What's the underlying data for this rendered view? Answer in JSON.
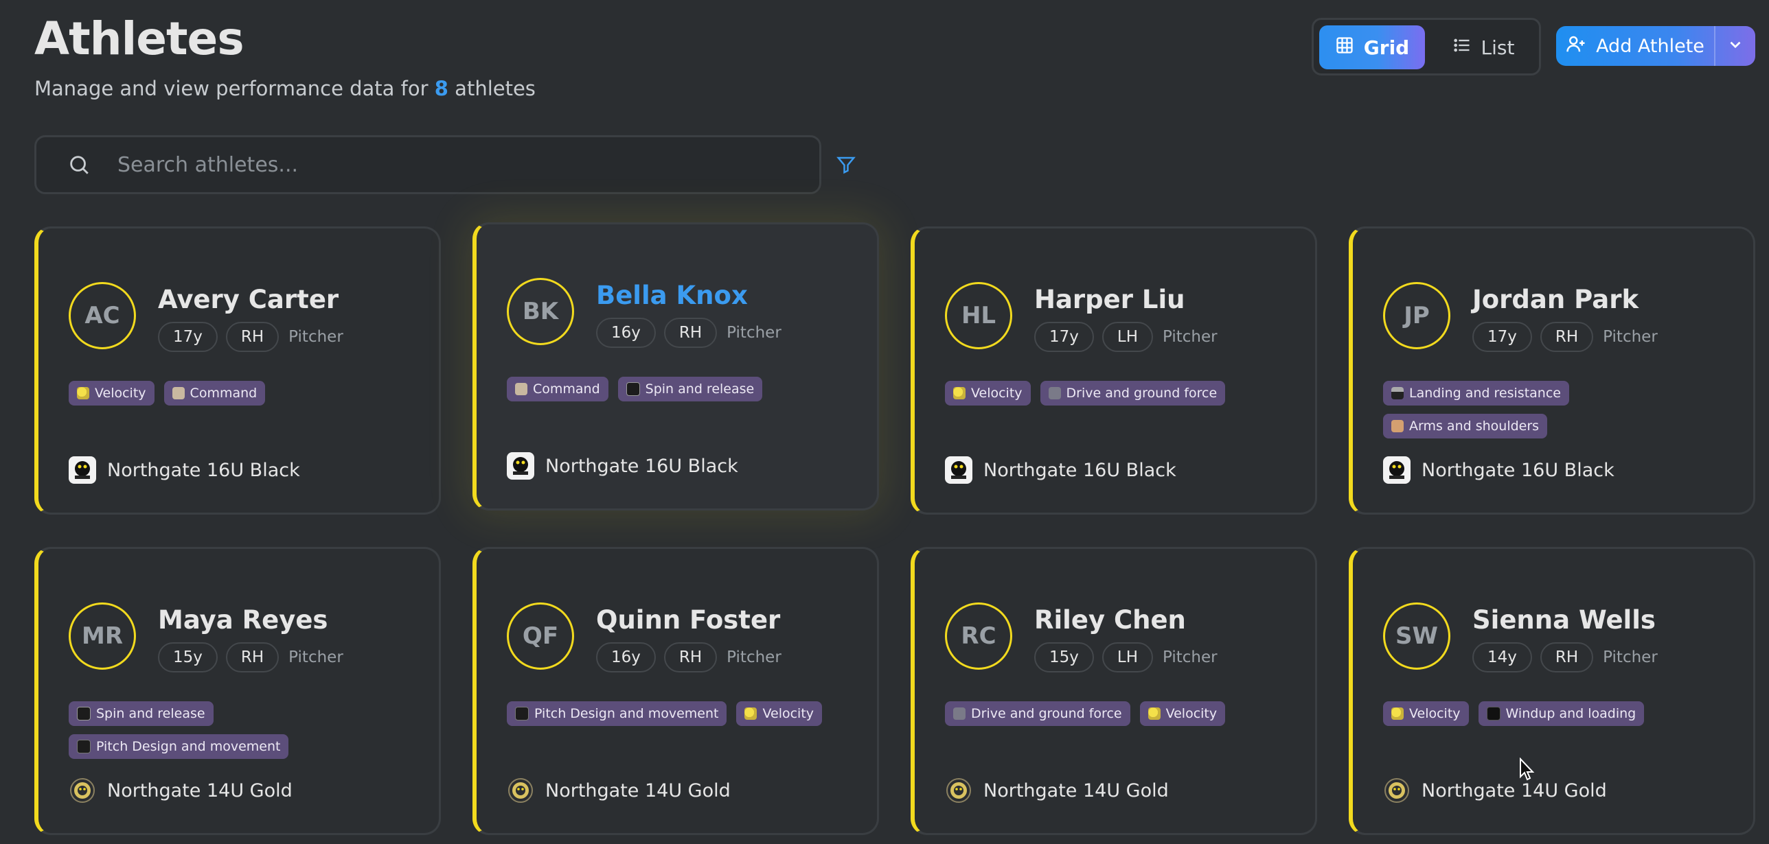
{
  "header": {
    "title": "Athletes",
    "subtitle_prefix": "Manage and view performance data for ",
    "athlete_count": "8",
    "subtitle_suffix": " athletes"
  },
  "view_toggle": {
    "grid_label": "Grid",
    "list_label": "List",
    "selected": "Grid"
  },
  "add_button": {
    "label": "Add Athlete"
  },
  "search": {
    "placeholder": "Search athletes...",
    "value": ""
  },
  "colors": {
    "accent": "#3b9bf0",
    "card_stripe": "#f2da1e",
    "tag_bg": "#5c4e7a",
    "background": "#2b2e31"
  },
  "athletes": [
    {
      "initials": "AC",
      "name": "Avery Carter",
      "age": "17y",
      "hand": "RH",
      "role": "Pitcher",
      "tags": [
        {
          "label": "Velocity",
          "icon": "velocity"
        },
        {
          "label": "Command",
          "icon": "command"
        }
      ],
      "team": "Northgate 16U Black",
      "team_logo": "black"
    },
    {
      "initials": "BK",
      "name": "Bella Knox",
      "age": "16y",
      "hand": "RH",
      "role": "Pitcher",
      "tags": [
        {
          "label": "Command",
          "icon": "command"
        },
        {
          "label": "Spin and release",
          "icon": "spin"
        }
      ],
      "team": "Northgate 16U Black",
      "team_logo": "black",
      "active": true
    },
    {
      "initials": "HL",
      "name": "Harper Liu",
      "age": "17y",
      "hand": "LH",
      "role": "Pitcher",
      "tags": [
        {
          "label": "Velocity",
          "icon": "velocity"
        },
        {
          "label": "Drive and ground force",
          "icon": "drive"
        }
      ],
      "team": "Northgate 16U Black",
      "team_logo": "black"
    },
    {
      "initials": "JP",
      "name": "Jordan Park",
      "age": "17y",
      "hand": "RH",
      "role": "Pitcher",
      "tags": [
        {
          "label": "Landing and resistance",
          "icon": "landing"
        },
        {
          "label": "Arms and shoulders",
          "icon": "arms"
        }
      ],
      "team": "Northgate 16U Black",
      "team_logo": "black"
    },
    {
      "initials": "MR",
      "name": "Maya Reyes",
      "age": "15y",
      "hand": "RH",
      "role": "Pitcher",
      "tags": [
        {
          "label": "Spin and release",
          "icon": "spin"
        },
        {
          "label": "Pitch Design and movement",
          "icon": "pitch"
        }
      ],
      "team": "Northgate 14U Gold",
      "team_logo": "gold"
    },
    {
      "initials": "QF",
      "name": "Quinn Foster",
      "age": "16y",
      "hand": "RH",
      "role": "Pitcher",
      "tags": [
        {
          "label": "Pitch Design and movement",
          "icon": "pitch"
        },
        {
          "label": "Velocity",
          "icon": "velocity"
        }
      ],
      "team": "Northgate 14U Gold",
      "team_logo": "gold"
    },
    {
      "initials": "RC",
      "name": "Riley Chen",
      "age": "15y",
      "hand": "LH",
      "role": "Pitcher",
      "tags": [
        {
          "label": "Drive and ground force",
          "icon": "drive"
        },
        {
          "label": "Velocity",
          "icon": "velocity"
        }
      ],
      "team": "Northgate 14U Gold",
      "team_logo": "gold"
    },
    {
      "initials": "SW",
      "name": "Sienna Wells",
      "age": "14y",
      "hand": "RH",
      "role": "Pitcher",
      "tags": [
        {
          "label": "Velocity",
          "icon": "velocity"
        },
        {
          "label": "Windup and loading",
          "icon": "windup"
        }
      ],
      "team": "Northgate 14U Gold",
      "team_logo": "gold"
    }
  ]
}
